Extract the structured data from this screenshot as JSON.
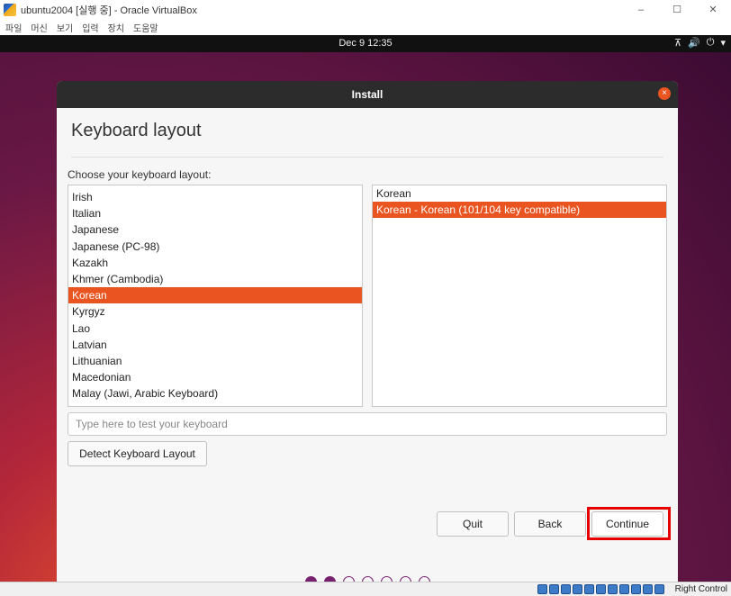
{
  "host_window": {
    "title": "ubuntu2004 [실행 중] - Oracle VirtualBox",
    "icon": "virtualbox-icon",
    "controls": [
      "–",
      "☐",
      "✕"
    ],
    "menu": [
      "파일",
      "머신",
      "보기",
      "입력",
      "장치",
      "도움말"
    ]
  },
  "topbar": {
    "clock": "Dec 9  12:35",
    "tray": [
      "network-icon",
      "volume-icon",
      "power-icon",
      "menu-arrow-icon"
    ],
    "tray_glyphs": [
      "⊼",
      "🔊",
      "⏻",
      "▾"
    ]
  },
  "dialog": {
    "title": "Install",
    "close_glyph": "×",
    "page_title": "Keyboard layout",
    "choose_label": "Choose your keyboard layout:",
    "layouts": [
      {
        "label": "Irish",
        "selected": false
      },
      {
        "label": "Italian",
        "selected": false
      },
      {
        "label": "Japanese",
        "selected": false
      },
      {
        "label": "Japanese (PC-98)",
        "selected": false
      },
      {
        "label": "Kazakh",
        "selected": false
      },
      {
        "label": "Khmer (Cambodia)",
        "selected": false
      },
      {
        "label": "Korean",
        "selected": true
      },
      {
        "label": "Kyrgyz",
        "selected": false
      },
      {
        "label": "Lao",
        "selected": false
      },
      {
        "label": "Latvian",
        "selected": false
      },
      {
        "label": "Lithuanian",
        "selected": false
      },
      {
        "label": "Macedonian",
        "selected": false
      },
      {
        "label": "Malay (Jawi, Arabic Keyboard)",
        "selected": false
      }
    ],
    "variants": [
      {
        "label": "Korean",
        "selected": false
      },
      {
        "label": "Korean - Korean (101/104 key compatible)",
        "selected": true
      }
    ],
    "test_input": {
      "value": "",
      "placeholder": "Type here to test your keyboard"
    },
    "detect_button": "Detect Keyboard Layout",
    "quit_button": "Quit",
    "back_button": "Back",
    "continue_button": "Continue",
    "progress": {
      "current_step": 2,
      "total_steps": 7
    }
  },
  "statusbar": {
    "host_key": "Right Control"
  },
  "colors": {
    "accent": "#e95420",
    "progress_dot": "#77216f",
    "highlight_box": "#e60000"
  }
}
